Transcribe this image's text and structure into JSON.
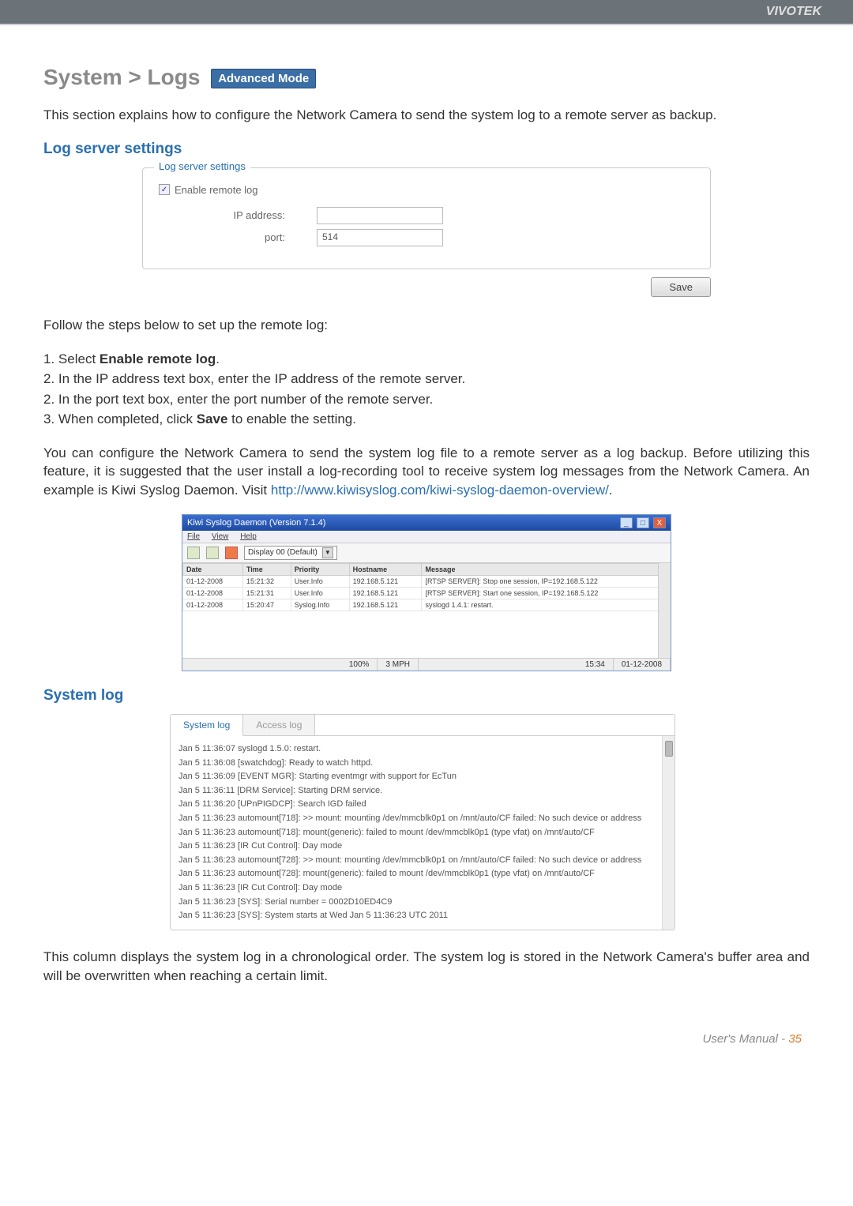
{
  "brand": "VIVOTEK",
  "title_prefix": "System > Logs",
  "badge": "Advanced Mode",
  "intro": "This section explains how to configure the Network Camera to send the system log to a remote server as backup.",
  "section_log_server": "Log server settings",
  "panel": {
    "title": "Log server settings",
    "checkbox_label": "Enable remote log",
    "ip_label": "IP address:",
    "ip_value": "",
    "port_label": "port:",
    "port_value": "514",
    "save": "Save"
  },
  "follow_steps": "Follow the steps below to set up the remote log:",
  "steps": [
    "Select <b>Enable remote log</b>.",
    "In the IP address text box, enter the IP address of the remote server.",
    "In the port text box, enter the port number of the remote server.",
    "When completed, click <b>Save</b> to enable the setting."
  ],
  "step_numbers": [
    "1",
    "2",
    "2",
    "3"
  ],
  "para_backup": "You can configure the Network Camera to send the system log file to a remote server as a log backup. Before utilizing this feature, it is suggested that the user install a log-recording tool to receive system log messages from the Network Camera. An example is Kiwi Syslog Daemon. Visit ",
  "link_url": "http://www.kiwisyslog.com/kiwi-syslog-daemon-overview/",
  "link_tr": ".",
  "kiwi": {
    "title": "Kiwi Syslog Daemon (Version 7.1.4)",
    "menu": [
      "File",
      "View",
      "Help"
    ],
    "dropdown": "Display 00 (Default)",
    "cols": [
      "Date",
      "Time",
      "Priority",
      "Hostname",
      "Message"
    ],
    "rows": [
      [
        "01-12-2008",
        "15:21:32",
        "User.Info",
        "192.168.5.121",
        "[RTSP SERVER]: Stop one session, IP=192.168.5.122"
      ],
      [
        "01-12-2008",
        "15:21:31",
        "User.Info",
        "192.168.5.121",
        "[RTSP SERVER]: Start one session, IP=192.168.5.122"
      ],
      [
        "01-12-2008",
        "15:20:47",
        "Syslog.Info",
        "192.168.5.121",
        "syslogd 1.4.1: restart."
      ]
    ],
    "status_pct": "100%",
    "status_rate": "3 MPH",
    "status_time": "15:34",
    "status_date": "01-12-2008"
  },
  "section_syslog": "System log",
  "tabs": {
    "active": "System log",
    "inactive": "Access log"
  },
  "syslog_lines": [
    "Jan 5 11:36:07 syslogd 1.5.0: restart.",
    "Jan 5 11:36:08 [swatchdog]: Ready to watch httpd.",
    "Jan 5 11:36:09 [EVENT MGR]: Starting eventmgr with support for EcTun",
    "Jan 5 11:36:11 [DRM Service]: Starting DRM service.",
    "Jan 5 11:36:20 [UPnPIGDCP]: Search IGD failed",
    "Jan 5 11:36:23 automount[718]: >> mount: mounting /dev/mmcblk0p1 on /mnt/auto/CF failed: No such device or address",
    "Jan 5 11:36:23 automount[718]: mount(generic): failed to mount /dev/mmcblk0p1 (type vfat) on /mnt/auto/CF",
    "Jan 5 11:36:23 [IR Cut Control]: Day mode",
    "Jan 5 11:36:23 automount[728]: >> mount: mounting /dev/mmcblk0p1 on /mnt/auto/CF failed: No such device or address",
    "Jan 5 11:36:23 automount[728]: mount(generic): failed to mount /dev/mmcblk0p1 (type vfat) on /mnt/auto/CF",
    "Jan 5 11:36:23 [IR Cut Control]: Day mode",
    "Jan 5 11:36:23 [SYS]: Serial number = 0002D10ED4C9",
    "Jan 5 11:36:23 [SYS]: System starts at Wed Jan 5 11:36:23 UTC 2011"
  ],
  "syslog_desc": "This column displays the system log in a chronological order. The system log is stored in the Network Camera's buffer area and will be overwritten when reaching a certain limit.",
  "footer_label": "User's Manual - ",
  "footer_page": "35"
}
